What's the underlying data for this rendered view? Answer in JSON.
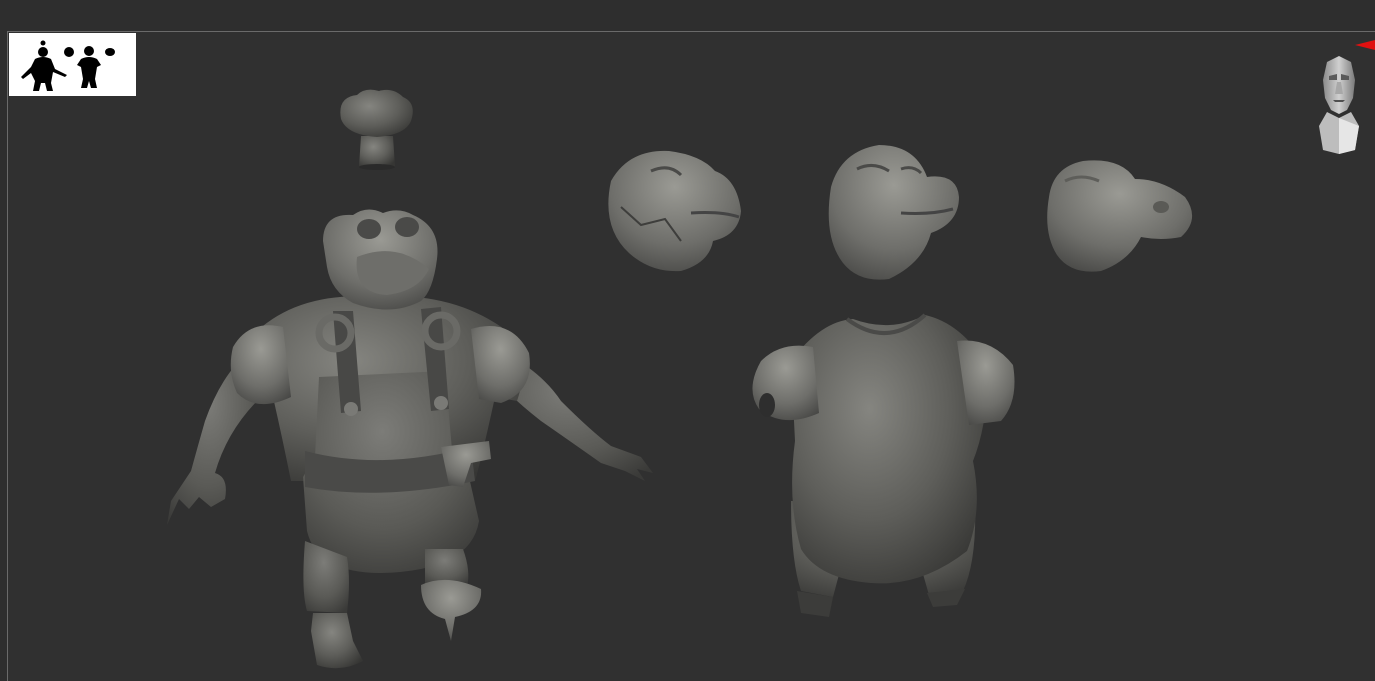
{
  "app": {
    "name": ""
  },
  "viewport": {
    "thumbnail": {
      "icon": "character-silhouette-thumbnail"
    },
    "navigation": {
      "icon": "head-navigation-gizmo"
    },
    "marker": {
      "icon": "red-arrow-marker"
    },
    "models": [
      {
        "id": "chef-hat-icon"
      },
      {
        "id": "croc-chef-full-body-icon"
      },
      {
        "id": "head-sculpt-a-icon"
      },
      {
        "id": "head-sculpt-b-icon"
      },
      {
        "id": "head-sculpt-c-icon"
      },
      {
        "id": "body-sculpt-shirt-icon"
      }
    ]
  },
  "colors": {
    "background": "#303030",
    "clay": "#5a5a58",
    "clay_light": "#7a7a76",
    "clay_dark": "#3a3a38"
  }
}
